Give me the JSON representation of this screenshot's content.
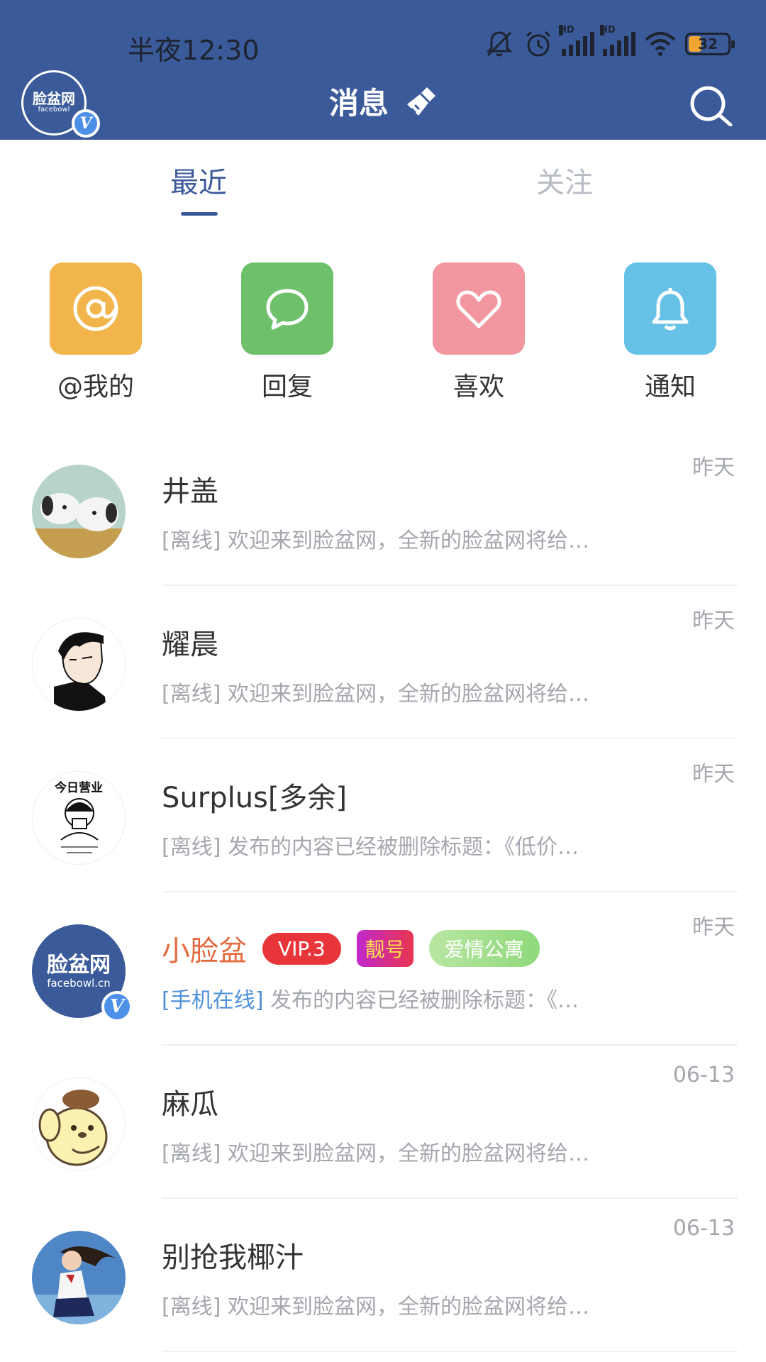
{
  "status_bar": {
    "time": "半夜12:30",
    "signal_label": "HD",
    "battery": "32",
    "icons": [
      "mute-icon",
      "alarm-icon",
      "signal-icon",
      "signal-icon",
      "wifi-icon",
      "battery-icon"
    ]
  },
  "header": {
    "logo_main": "脸盆网",
    "logo_sub": "facebowl",
    "verified": "V",
    "title": "消息",
    "clean_icon": "broom-icon",
    "search_icon": "search-icon"
  },
  "tabs": [
    {
      "label": "最近",
      "active": true
    },
    {
      "label": "关注",
      "active": false
    }
  ],
  "quick_actions": [
    {
      "label": "@我的",
      "icon": "at-icon",
      "color": "#f1b54c"
    },
    {
      "label": "回复",
      "icon": "chat-bubble-icon",
      "color": "#6ec06a"
    },
    {
      "label": "喜欢",
      "icon": "heart-icon",
      "color": "#f2979f"
    },
    {
      "label": "通知",
      "icon": "bell-icon",
      "color": "#66c1e6"
    }
  ],
  "conversations": [
    {
      "name": "井﻿盖﻿",
      "status": "[离线]",
      "preview": "欢迎来到脸盆网，全新的脸盆网将给…",
      "time": "昨天"
    },
    {
      "name": "耀晨",
      "status": "[离线]",
      "preview": "欢迎来到脸盆网，全新的脸盆网将给…",
      "time": "昨天"
    },
    {
      "name": "Surplus[多余]",
      "status": "[离线]",
      "preview": "发布的内容已经被删除标题：《低价…",
      "time": "昨天",
      "avatar_text": "今日营业"
    },
    {
      "name": "小脸盆",
      "status": "[手机在线]",
      "preview": "发布的内容已经被删除标题：《…",
      "time": "昨天",
      "badges": [
        "VIP.3",
        "靓号",
        "爱情公寓"
      ],
      "avatar_main": "脸盆网",
      "avatar_sub": "facebowl.cn",
      "verified": "V"
    },
    {
      "name": "麻瓜",
      "status": "[离线]",
      "preview": "欢迎来到脸盆网，全新的脸盆网将给…",
      "time": "06-13"
    },
    {
      "name": "别抢我椰汁",
      "status": "[离线]",
      "preview": "欢迎来到脸盆网，全新的脸盆网将给…",
      "time": "06-13"
    }
  ]
}
